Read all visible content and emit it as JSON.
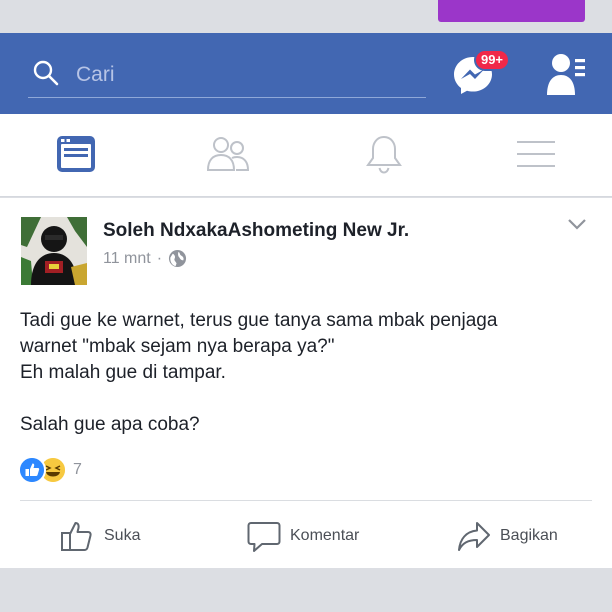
{
  "header": {
    "search": {
      "placeholder": "Cari"
    },
    "messenger_badge": "99+"
  },
  "tabs": [
    "news-feed",
    "friends",
    "notifications",
    "menu"
  ],
  "post": {
    "author": "Soleh NdxakaAshometing New Jr.",
    "time": "11 mnt",
    "separator": "·",
    "lines": [
      "Tadi gue ke warnet, terus gue tanya sama mbak penjaga",
      "warnet \"mbak sejam nya berapa ya?\"",
      "Eh malah gue di tampar.",
      "Salah gue apa coba?"
    ],
    "reactions": {
      "count": "7",
      "types": [
        "like",
        "haha"
      ]
    },
    "actions": {
      "like": "Suka",
      "comment": "Komentar",
      "share": "Bagikan"
    }
  },
  "colors": {
    "brand_blue": "#4267b2",
    "badge_red": "#f02849",
    "purple_tab": "#9b36c9",
    "like_blue": "#2d88ff",
    "haha_yellow": "#f7c940"
  }
}
